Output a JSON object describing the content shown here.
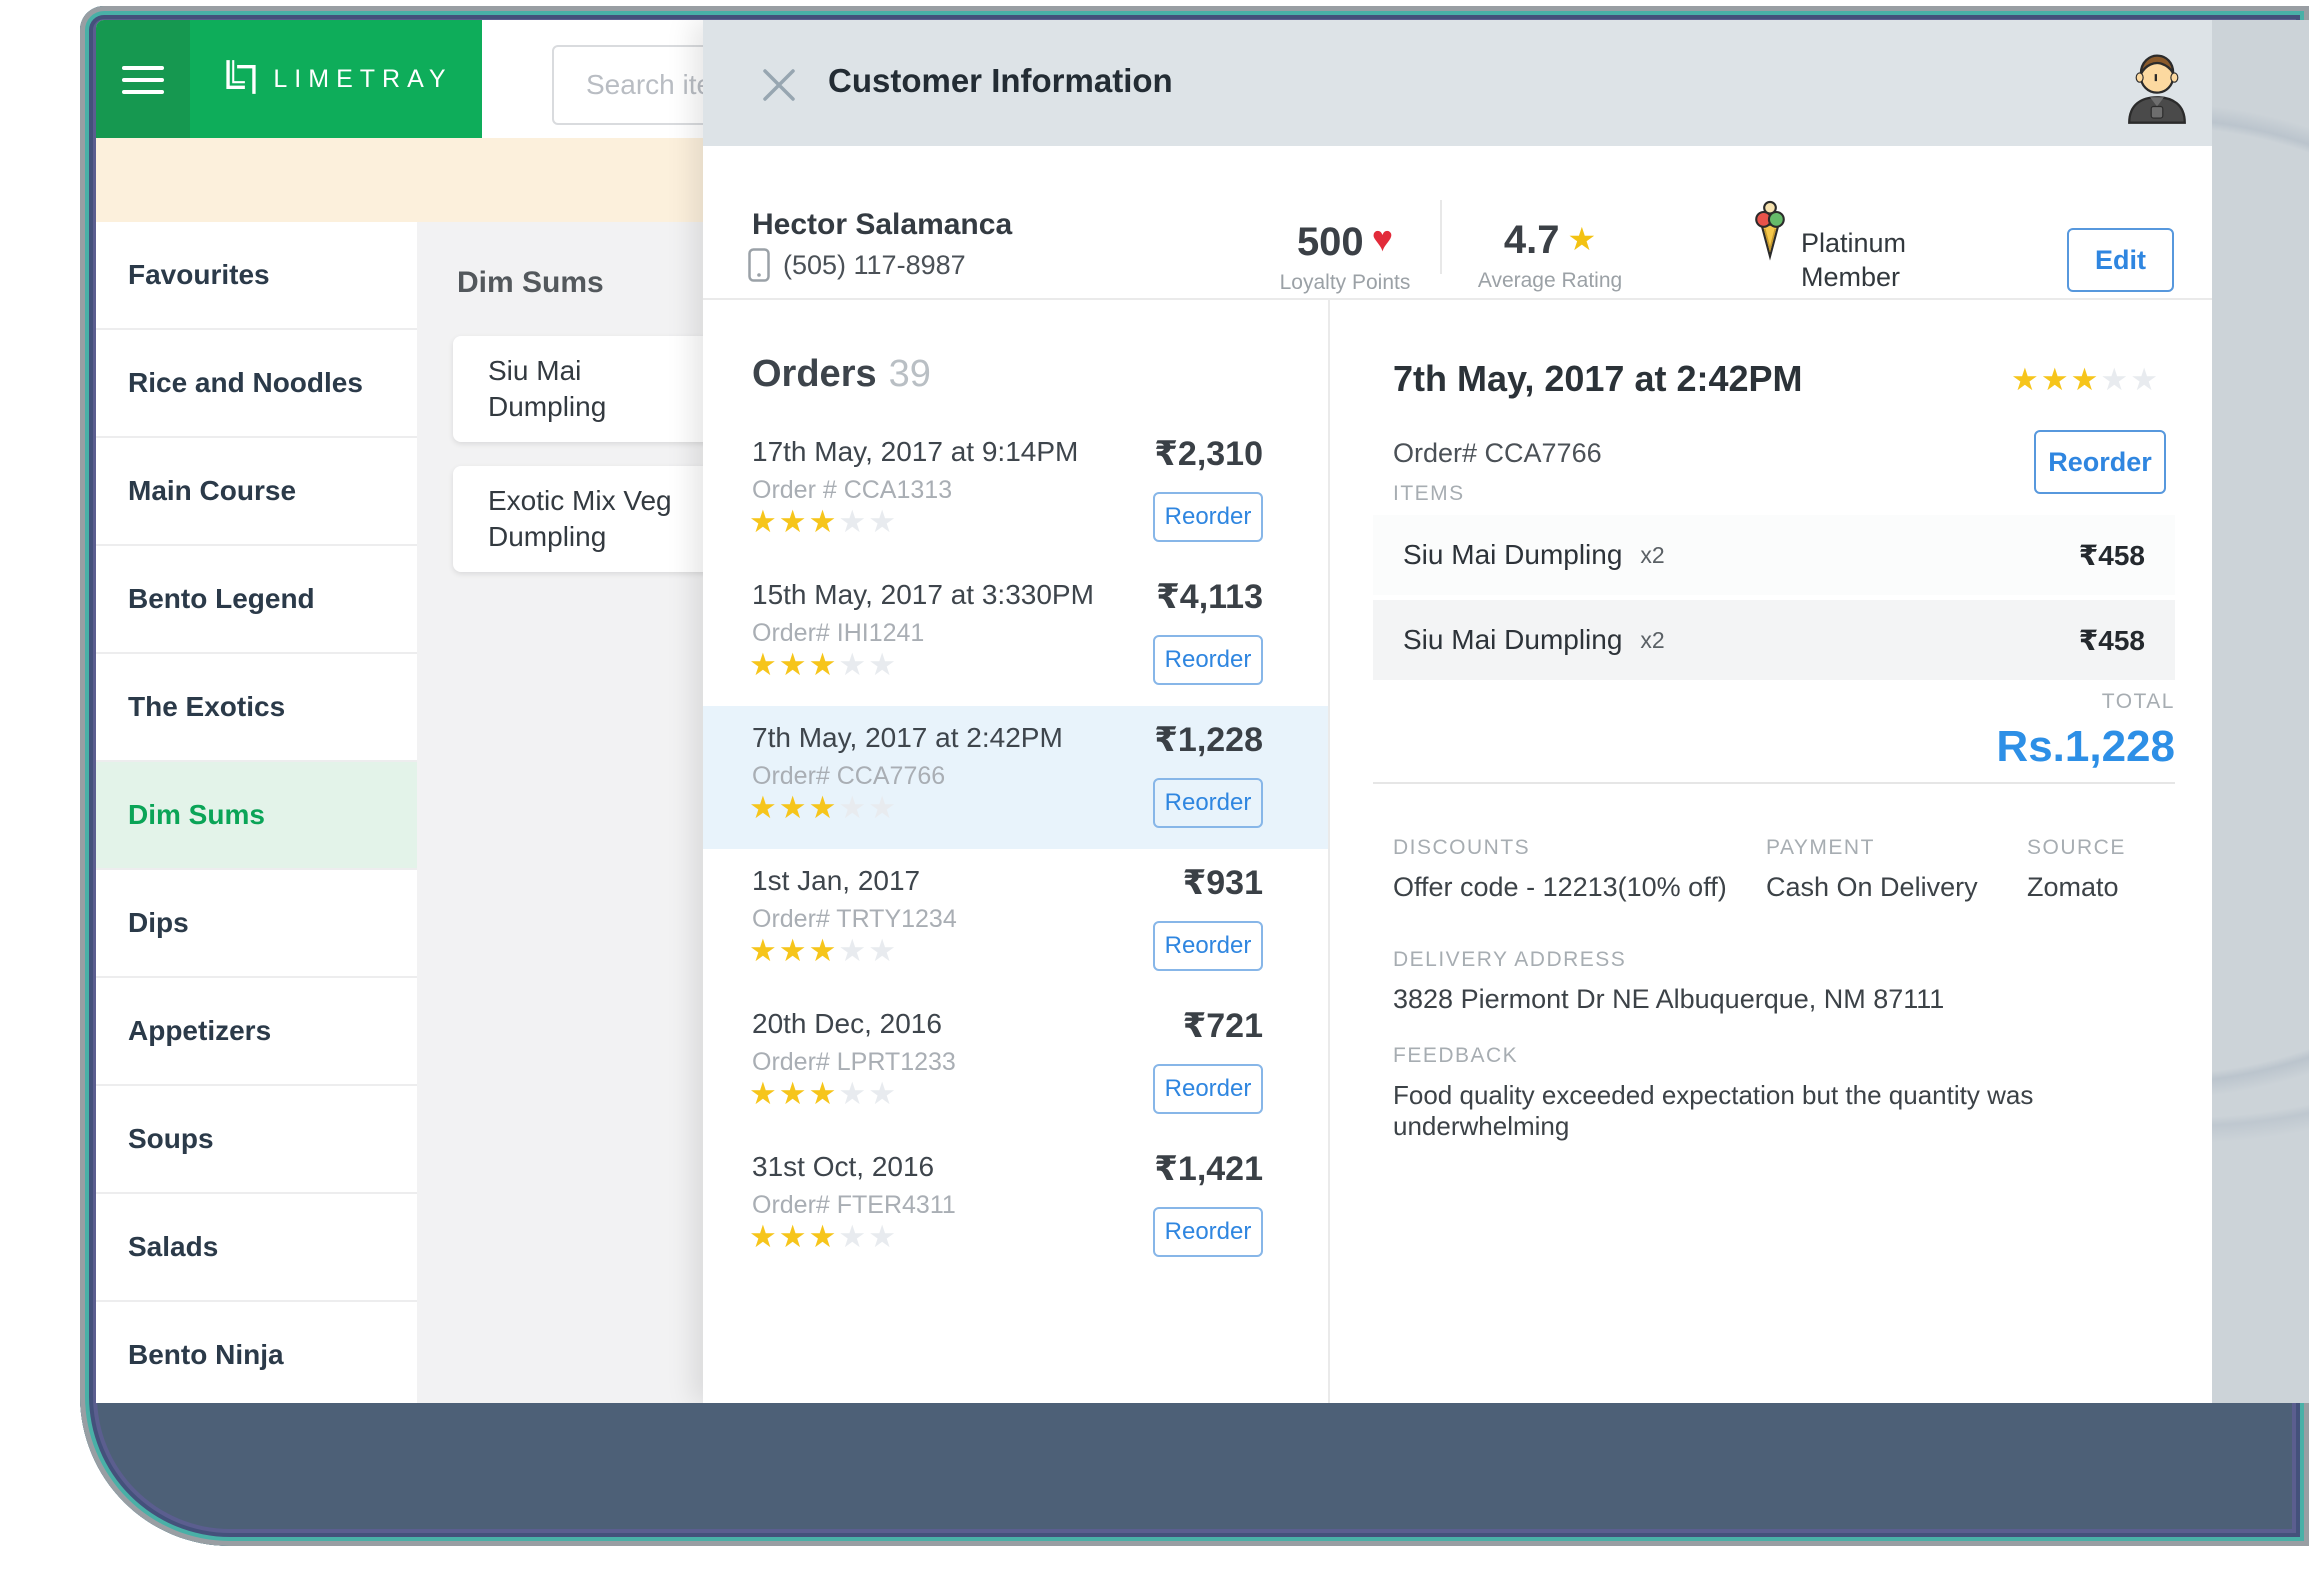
{
  "brand": {
    "logo_text": "LIMETRAY"
  },
  "header": {
    "search_placeholder": "Search items and Categories"
  },
  "sidebar": {
    "items": [
      {
        "label": "Favourites"
      },
      {
        "label": "Rice and Noodles"
      },
      {
        "label": "Main Course"
      },
      {
        "label": "Bento Legend"
      },
      {
        "label": "The Exotics"
      },
      {
        "label": "Dim Sums",
        "selected": true
      },
      {
        "label": "Dips"
      },
      {
        "label": "Appetizers"
      },
      {
        "label": "Soups"
      },
      {
        "label": "Salads"
      },
      {
        "label": "Bento Ninja"
      }
    ]
  },
  "menu": {
    "title": "Dim Sums",
    "items": [
      {
        "name": "Siu Mai Dumpling"
      },
      {
        "name": "Exotic Mix Veg Dumpling"
      }
    ]
  },
  "panel": {
    "title": "Customer Information",
    "customer": {
      "name": "Hector Salamanca",
      "phone": "(505) 117-8987",
      "loyalty_points": "500",
      "loyalty_label": "Loyalty Points",
      "rating": "4.7",
      "rating_label": "Average Rating",
      "membership_line1": "Platinum",
      "membership_line2": "Member",
      "edit_label": "Edit"
    },
    "orders": {
      "title": "Orders",
      "count": "39",
      "list": [
        {
          "date": "17th May, 2017 at 9:14PM",
          "order_no": "Order # CCA1313",
          "price": "₹2,310",
          "stars": 3,
          "reorder_label": "Reorder"
        },
        {
          "date": "15th May, 2017 at 3:330PM",
          "order_no": "Order# IHI1241",
          "price": "₹4,113",
          "stars": 3,
          "reorder_label": "Reorder"
        },
        {
          "date": "7th May, 2017 at 2:42PM",
          "order_no": "Order# CCA7766",
          "price": "₹1,228",
          "stars": 3,
          "selected": true,
          "reorder_label": "Reorder"
        },
        {
          "date": "1st Jan, 2017",
          "order_no": "Order# TRTY1234",
          "price": "₹931",
          "stars": 3,
          "reorder_label": "Reorder"
        },
        {
          "date": "20th Dec, 2016",
          "order_no": "Order# LPRT1233",
          "price": "₹721",
          "stars": 3,
          "reorder_label": "Reorder"
        },
        {
          "date": "31st Oct, 2016",
          "order_no": "Order# FTER4311",
          "price": "₹1,421",
          "stars": 3,
          "reorder_label": "Reorder"
        }
      ]
    },
    "detail": {
      "date": "7th May, 2017 at 2:42PM",
      "order_no": "Order# CCA7766",
      "stars": 3,
      "reorder_label": "Reorder",
      "items_label": "ITEMS",
      "items": [
        {
          "name": "Siu Mai Dumpling",
          "qty": "x2",
          "price": "₹458"
        },
        {
          "name": "Siu Mai Dumpling",
          "qty": "x2",
          "price": "₹458"
        }
      ],
      "total_label": "TOTAL",
      "total": "Rs.1,228",
      "discounts_label": "DISCOUNTS",
      "discounts": "Offer code - 12213(10% off)",
      "payment_label": "PAYMENT",
      "payment": "Cash On Delivery",
      "source_label": "SOURCE",
      "source": "Zomato",
      "address_label": "DELIVERY ADDRESS",
      "address": "3828 Piermont Dr NE Albuquerque, NM 87111",
      "feedback_label": "FEEDBACK",
      "feedback": "Food quality exceeded expectation but the quantity was underwhelming"
    }
  },
  "colors": {
    "brand_green_dark": "#169850",
    "brand_green": "#0ead5a",
    "accent_blue": "#2f86e0",
    "total_blue": "#2d8fe6",
    "star_gold": "#f6c51b",
    "heart_red": "#e22b3a",
    "selected_row_blue": "#e8f3fb",
    "selected_sidebar_green": "#e3f3e9"
  }
}
